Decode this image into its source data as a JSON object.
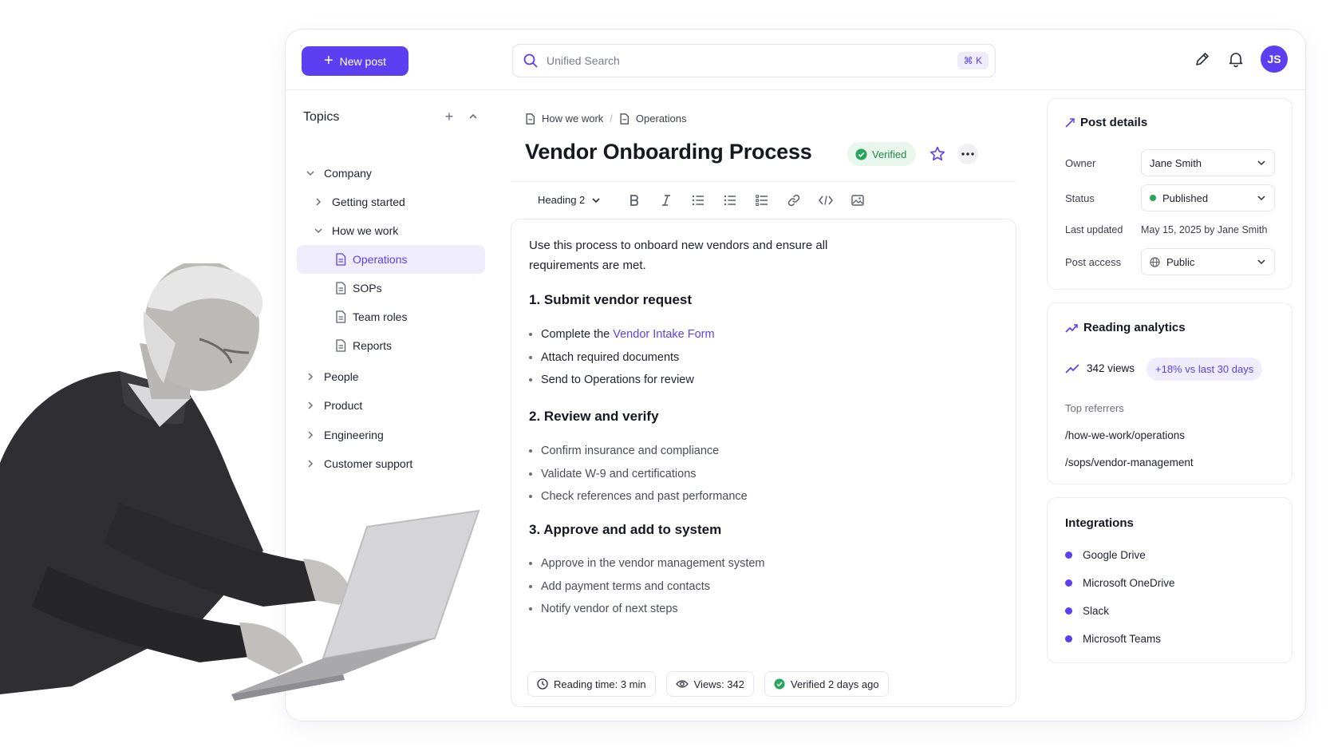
{
  "topbar": {
    "new_post_label": "New post",
    "search_placeholder": "Unified Search",
    "search_shortcut": "⌘ K",
    "avatar_initials": "JS"
  },
  "sidebar": {
    "title": "Topics",
    "items": [
      {
        "label": "Company",
        "level": 0,
        "expanded": true
      },
      {
        "label": "Getting started",
        "level": 1,
        "expanded": false
      },
      {
        "label": "How we work",
        "level": 1,
        "expanded": true
      },
      {
        "label": "Operations",
        "level": 2,
        "active": true
      },
      {
        "label": "SOPs",
        "level": 2
      },
      {
        "label": "Team roles",
        "level": 2
      },
      {
        "label": "Reports",
        "level": 2
      },
      {
        "label": "People",
        "level": 0,
        "expanded": false
      },
      {
        "label": "Product",
        "level": 0,
        "expanded": false
      },
      {
        "label": "Engineering",
        "level": 0,
        "expanded": false
      },
      {
        "label": "Customer support",
        "level": 0,
        "expanded": false
      }
    ]
  },
  "main": {
    "breadcrumb": [
      "How we work",
      "Operations"
    ],
    "title": "Vendor Onboarding Process",
    "verified_label": "Verified",
    "toolbar": {
      "heading_label": "Heading 2"
    },
    "intro": "Use this process to onboard new vendors and ensure all requirements are met.",
    "sections": [
      {
        "heading": "1. Submit vendor request",
        "items": [
          "Complete the",
          "Attach required documents",
          "Send to Operations for review"
        ],
        "link": "Vendor Intake Form"
      },
      {
        "heading": "2. Review and verify",
        "items": [
          "Confirm insurance and compliance",
          "Validate W-9 and certifications",
          "Check references and past performance"
        ]
      },
      {
        "heading": "3. Approve and add to system",
        "items": [
          "Approve in the vendor management system",
          "Add payment terms and contacts",
          "Notify vendor of next steps"
        ]
      }
    ],
    "footer_chips": [
      "Reading time: 3 min",
      "Views: 342",
      "Verified 2 days ago"
    ]
  },
  "post_details": {
    "title": "Post details",
    "owner_label": "Owner",
    "owner_value": "Jane Smith",
    "status_label": "Status",
    "status_value": "Published",
    "updated_label": "Last updated",
    "updated_value": "May 15, 2025 by Jane Smith",
    "access_label": "Post access",
    "access_value": "Public"
  },
  "analytics": {
    "title": "Reading analytics",
    "views": "342 views",
    "change": "+18% vs last 30 days",
    "referrers_label": "Top referrers",
    "referrers": [
      "/how-we-work/operations",
      "/sops/vendor-management"
    ]
  },
  "integrations": {
    "title": "Integrations",
    "items": [
      "Google Drive",
      "Microsoft OneDrive",
      "Slack",
      "Microsoft Teams"
    ]
  },
  "colors": {
    "accent": "#5b3ff0",
    "success": "#27a55a"
  }
}
